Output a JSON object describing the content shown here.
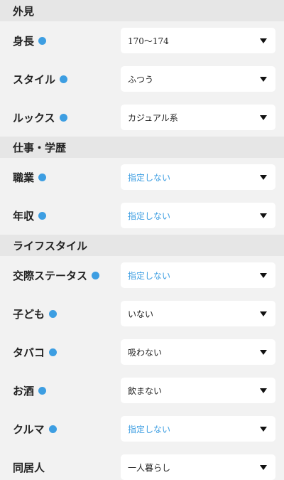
{
  "colors": {
    "accent": "#3d9ee2",
    "section_bg": "#e6e6e6",
    "page_bg": "#f2f2f2"
  },
  "sections": [
    {
      "title": "外見",
      "fields": [
        {
          "label": "身長",
          "value": "170〜174",
          "placeholder": false
        },
        {
          "label": "スタイル",
          "value": "ふつう",
          "placeholder": false
        },
        {
          "label": "ルックス",
          "value": "カジュアル系",
          "placeholder": false
        }
      ]
    },
    {
      "title": "仕事・学歴",
      "fields": [
        {
          "label": "職業",
          "value": "指定しない",
          "placeholder": true
        },
        {
          "label": "年収",
          "value": "指定しない",
          "placeholder": true
        }
      ]
    },
    {
      "title": "ライフスタイル",
      "fields": [
        {
          "label": "交際ステータス",
          "value": "指定しない",
          "placeholder": true
        },
        {
          "label": "子ども",
          "value": "いない",
          "placeholder": false
        },
        {
          "label": "タバコ",
          "value": "吸わない",
          "placeholder": false
        },
        {
          "label": "お酒",
          "value": "飲まない",
          "placeholder": false
        },
        {
          "label": "クルマ",
          "value": "指定しない",
          "placeholder": true
        },
        {
          "label": "同居人",
          "value": "一人暮らし",
          "placeholder": false,
          "no_dot": true
        }
      ]
    }
  ]
}
